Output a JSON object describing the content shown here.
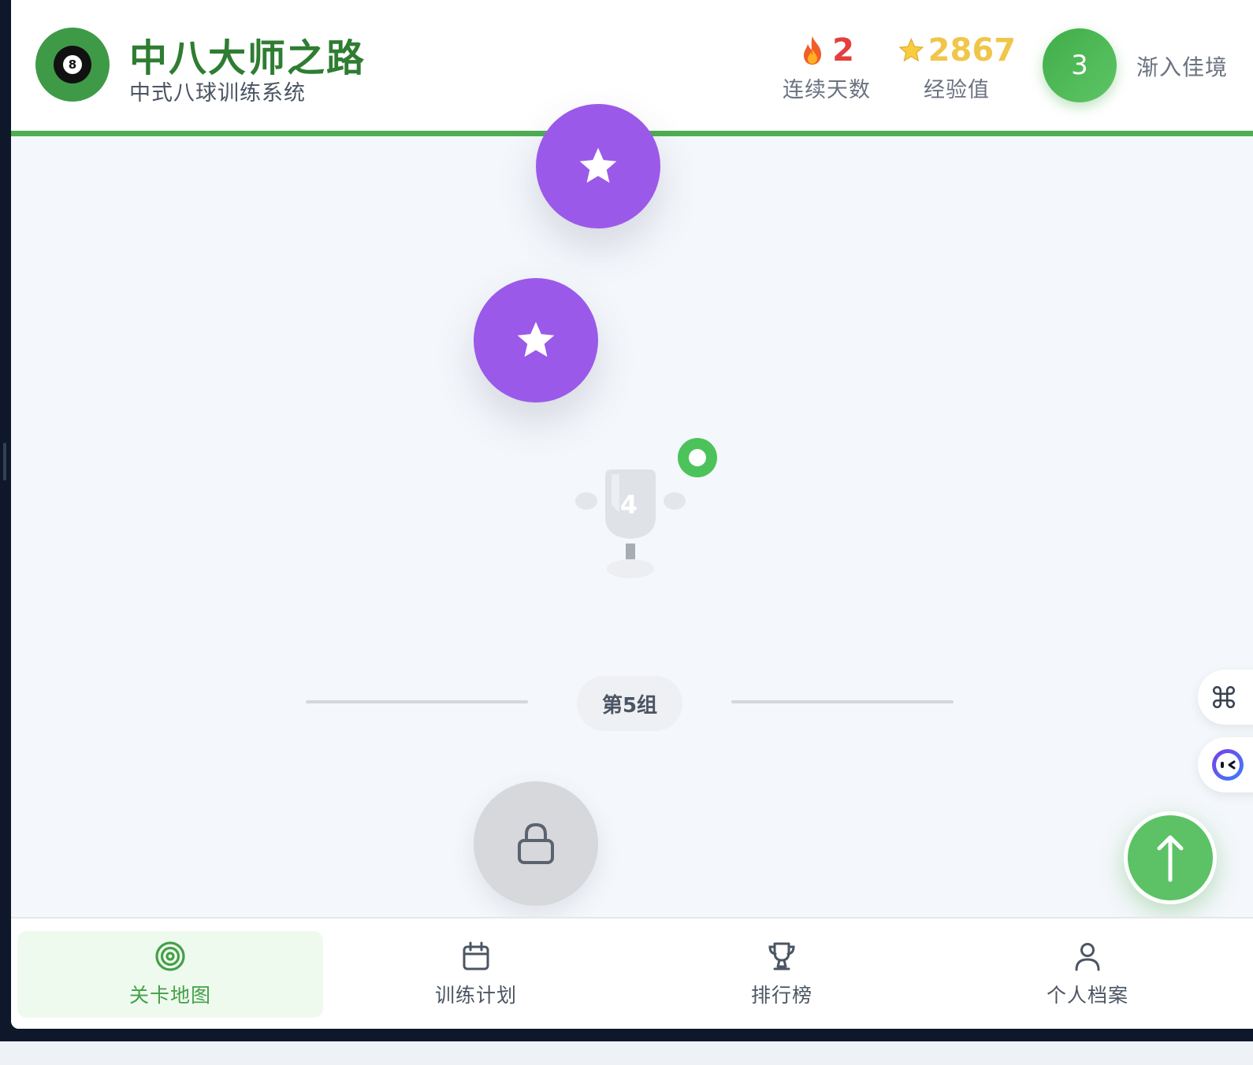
{
  "header": {
    "logo_ball_number": "8",
    "title": "中八大师之路",
    "subtitle": "中式八球训练系统",
    "streak": {
      "icon": "fire-icon",
      "value": "2",
      "label": "连续天数"
    },
    "xp": {
      "icon": "star-icon",
      "value": "2867",
      "label": "经验值"
    },
    "level": {
      "number": "3",
      "name": "渐入佳境"
    }
  },
  "map": {
    "nodes": [
      {
        "status": "completed",
        "icon": "star-icon"
      },
      {
        "status": "completed",
        "icon": "star-icon"
      },
      {
        "status": "current",
        "type": "trophy",
        "number": "4"
      },
      {
        "status": "locked",
        "icon": "lock-icon"
      }
    ],
    "group_label": "第5组"
  },
  "floating": {
    "shortcut_icon": "command-icon",
    "assistant_icon": "assistant-icon",
    "scroll_top_icon": "arrow-up-icon"
  },
  "nav": {
    "items": [
      {
        "label": "关卡地图",
        "icon": "target-icon",
        "active": true
      },
      {
        "label": "训练计划",
        "icon": "calendar-icon",
        "active": false
      },
      {
        "label": "排行榜",
        "icon": "trophy-icon",
        "active": false
      },
      {
        "label": "个人档案",
        "icon": "user-icon",
        "active": false
      }
    ]
  },
  "colors": {
    "primary_green": "#4caf50",
    "title_green": "#2e7d32",
    "completed_purple": "#9b59ea",
    "locked_gray": "#d6d8dc",
    "streak_red": "#e53e3e",
    "xp_gold": "#f0c64a"
  }
}
